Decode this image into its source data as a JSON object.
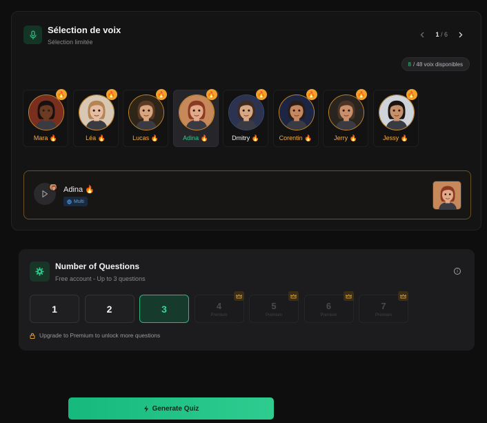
{
  "voice_panel": {
    "title": "Sélection de voix",
    "subtitle": "Sélection limitée",
    "icon": "microphone-icon",
    "pagination": {
      "current": "1",
      "separator": " / ",
      "total": "6"
    },
    "available": {
      "count": "8",
      "text": "/ 48 voix disponibles"
    },
    "voices": [
      {
        "name": "Mara",
        "emoji": "🔥",
        "style": "gold",
        "skin": "#6a3a22",
        "hair": "#1a1010",
        "bg": "#7a2e1e"
      },
      {
        "name": "Léa",
        "emoji": "🔥",
        "style": "gold",
        "skin": "#e6bda0",
        "hair": "#b58454",
        "bg": "#d8c7b2"
      },
      {
        "name": "Lucas",
        "emoji": "🔥",
        "style": "gold",
        "skin": "#d9a57e",
        "hair": "#5b3a24",
        "bg": "#2e2418"
      },
      {
        "name": "Adina",
        "emoji": "🔥",
        "style": "green",
        "selected": true,
        "skin": "#e2a888",
        "hair": "#8a3a22",
        "bg": "#c7885a"
      },
      {
        "name": "Dmitry",
        "emoji": "🔥",
        "style": "white",
        "skin": "#d8a884",
        "hair": "#3e2a20",
        "bg": "#2b3350"
      },
      {
        "name": "Corentin",
        "emoji": "🔥",
        "style": "gold",
        "skin": "#c58760",
        "hair": "#2a1c16",
        "bg": "#1c2644"
      },
      {
        "name": "Jerry",
        "emoji": "🔥",
        "style": "gold",
        "skin": "#c98e6a",
        "hair": "#4a3426",
        "bg": "#2a2420"
      },
      {
        "name": "Jessy",
        "emoji": "🔥",
        "style": "gold",
        "skin": "#c6906a",
        "hair": "#1c1412",
        "bg": "#cfd3da"
      }
    ]
  },
  "player": {
    "name": "Adina",
    "emoji": "🔥",
    "badge": "Multi",
    "play_icon": "play-icon"
  },
  "questions": {
    "title": "Number of Questions",
    "subtitle": "Free account - Up to 3 questions",
    "icon": "gear-icon",
    "options": [
      {
        "label": "1",
        "state": "free"
      },
      {
        "label": "2",
        "state": "free"
      },
      {
        "label": "3",
        "state": "selected"
      },
      {
        "label": "4",
        "state": "locked",
        "note": "Premium"
      },
      {
        "label": "5",
        "state": "locked",
        "note": "Premium"
      },
      {
        "label": "6",
        "state": "locked",
        "note": "Premium"
      },
      {
        "label": "7",
        "state": "locked",
        "note": "Premium"
      }
    ],
    "upgrade_text": "Upgrade to Premium to unlock more questions"
  },
  "generate_button": {
    "label": "Generate Quiz",
    "icon": "lightning-icon"
  },
  "colors": {
    "accent": "#2ecc8f",
    "gold": "#f2a22c",
    "background": "#0e0e0f"
  }
}
